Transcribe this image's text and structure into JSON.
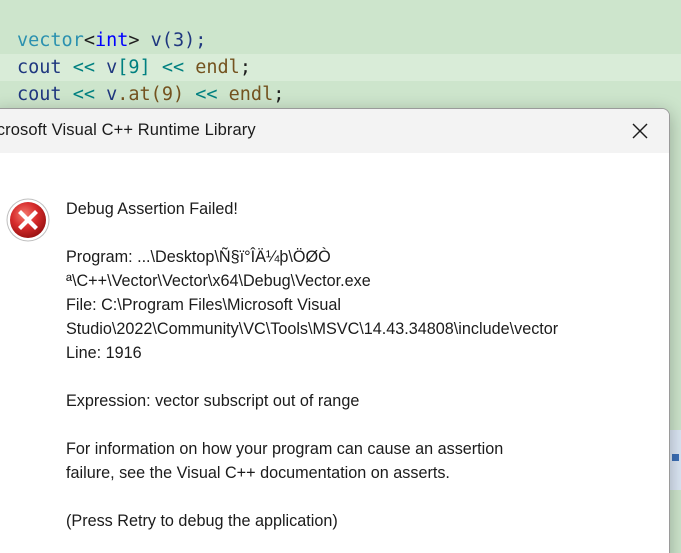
{
  "editor": {
    "lines": [
      {
        "a": "vector",
        "b": "<",
        "c": "int",
        "d": ">",
        "e": " v(3);"
      },
      {
        "a": "cout",
        "b": " << ",
        "c": "v",
        "d": "[9]",
        "e": " << ",
        "f": "endl",
        "g": ";"
      },
      {
        "a": "cout",
        "b": " << ",
        "c": "v",
        "d": ".at(9)",
        "e": " << ",
        "f": "endl",
        "g": ";"
      }
    ]
  },
  "dialog": {
    "title": "icrosoft Visual C++ Runtime Library",
    "close_icon": "close-icon",
    "icon": "error-icon",
    "heading": "Debug Assertion Failed!",
    "program_line1": "Program: ...\\Desktop\\Ñ§ï°ÎÄ¼þ\\ÖØÒ",
    "program_line2": "ª\\C++\\Vector\\Vector\\x64\\Debug\\Vector.exe",
    "file_line1": "File: C:\\Program Files\\Microsoft Visual",
    "file_line2": "Studio\\2022\\Community\\VC\\Tools\\MSVC\\14.43.34808\\include\\vector",
    "line_number": "Line: 1916",
    "expression": "Expression: vector subscript out of range",
    "info_line1": "For information on how your program can cause an assertion",
    "info_line2": "failure, see the Visual C++ documentation on asserts.",
    "retry_hint": "(Press Retry to debug the application)"
  },
  "colors": {
    "editor_bg": "#cde5cc",
    "error_red": "#d62b2b",
    "dialog_bg": "#ffffff"
  }
}
